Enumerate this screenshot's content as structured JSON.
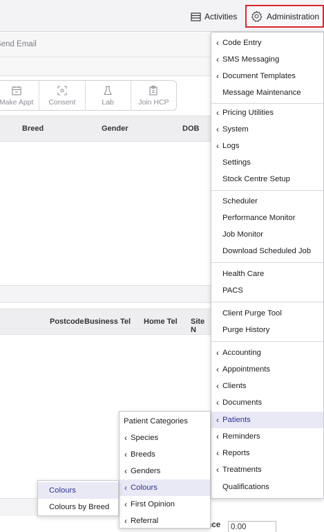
{
  "topbar": {
    "activities_label": "Activities",
    "administration_label": "Administration",
    "accent_color": "#d9262e"
  },
  "background": {
    "send_email_label": "Send Email",
    "actions": [
      {
        "label": "Make Appt",
        "icon": "calendar-icon"
      },
      {
        "label": "Consent",
        "icon": "scan-icon"
      },
      {
        "label": "Lab",
        "icon": "flask-icon"
      },
      {
        "label": "Join HCP",
        "icon": "clipboard-icon"
      }
    ],
    "patient_columns": [
      "Breed",
      "Gender",
      "DOB"
    ],
    "client_columns": [
      "Postcode",
      "Business Tel",
      "Home Tel",
      "Site N"
    ],
    "balance_label": "Balance",
    "balance_value": "0.00"
  },
  "admin_menu": {
    "items": [
      {
        "label": "Code Entry",
        "submenu": true
      },
      {
        "label": "SMS Messaging",
        "submenu": true
      },
      {
        "label": "Document Templates",
        "submenu": true
      },
      {
        "label": "Message Maintenance",
        "submenu": false
      },
      {
        "label": "Pricing Utilities",
        "submenu": true
      },
      {
        "label": "System",
        "submenu": true
      },
      {
        "label": "Logs",
        "submenu": true
      },
      {
        "label": "Settings",
        "submenu": false
      },
      {
        "label": "Stock Centre Setup",
        "submenu": false
      },
      {
        "label": "Scheduler",
        "submenu": false
      },
      {
        "label": "Performance Monitor",
        "submenu": false
      },
      {
        "label": "Job Monitor",
        "submenu": false
      },
      {
        "label": "Download Scheduled Job",
        "submenu": false
      },
      {
        "label": "Health Care",
        "submenu": false
      },
      {
        "label": "PACS",
        "submenu": false
      },
      {
        "label": "Client Purge Tool",
        "submenu": false
      },
      {
        "label": "Purge History",
        "submenu": false
      },
      {
        "label": "Accounting",
        "submenu": true
      },
      {
        "label": "Appointments",
        "submenu": true
      },
      {
        "label": "Clients",
        "submenu": true
      },
      {
        "label": "Documents",
        "submenu": true
      },
      {
        "label": "Patients",
        "submenu": true,
        "highlighted": true
      },
      {
        "label": "Reminders",
        "submenu": true
      },
      {
        "label": "Reports",
        "submenu": true
      },
      {
        "label": "Treatments",
        "submenu": true
      },
      {
        "label": "Qualifications",
        "submenu": false
      }
    ]
  },
  "patients_menu": {
    "items": [
      {
        "label": "Patient Categories",
        "submenu": false
      },
      {
        "label": "Species",
        "submenu": true
      },
      {
        "label": "Breeds",
        "submenu": true
      },
      {
        "label": "Genders",
        "submenu": true
      },
      {
        "label": "Colours",
        "submenu": true,
        "highlighted": true
      },
      {
        "label": "First Opinion",
        "submenu": true
      },
      {
        "label": "Referral",
        "submenu": true
      }
    ]
  },
  "colours_menu": {
    "items": [
      {
        "label": "Colours",
        "highlighted": true
      },
      {
        "label": "Colours by Breed"
      }
    ]
  }
}
